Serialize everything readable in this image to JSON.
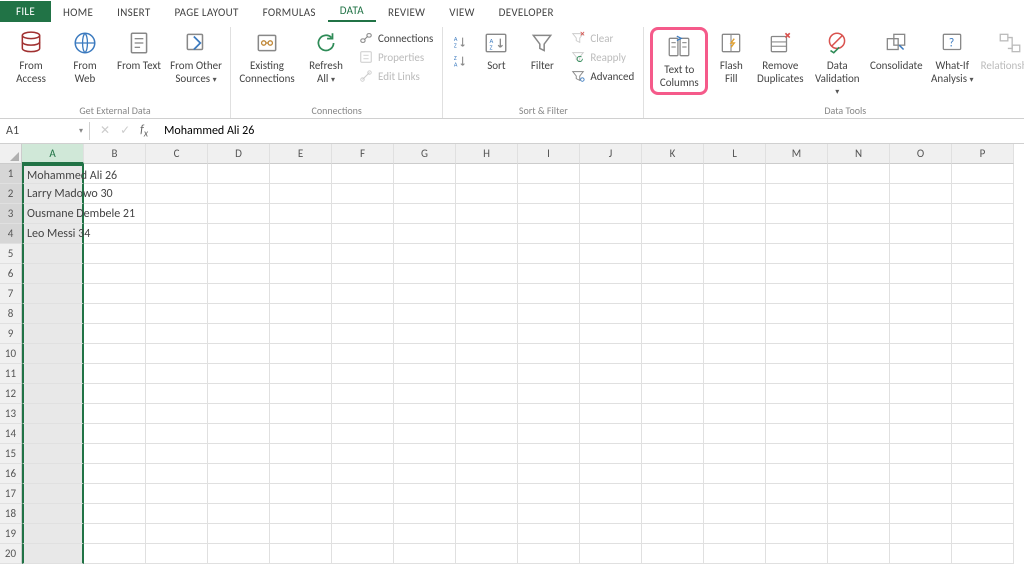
{
  "tabs": {
    "file": "FILE",
    "home": "HOME",
    "insert": "INSERT",
    "page_layout": "PAGE LAYOUT",
    "formulas": "FORMULAS",
    "data": "DATA",
    "review": "REVIEW",
    "view": "VIEW",
    "developer": "DEVELOPER"
  },
  "ribbon": {
    "get_external": {
      "label": "Get External Data",
      "from_access": "From Access",
      "from_web": "From Web",
      "from_text": "From Text",
      "from_other": "From Other Sources"
    },
    "connections": {
      "label": "Connections",
      "existing": "Existing Connections",
      "refresh": "Refresh All",
      "conn": "Connections",
      "props": "Properties",
      "edit": "Edit Links"
    },
    "sort_filter": {
      "label": "Sort & Filter",
      "sort": "Sort",
      "filter": "Filter",
      "clear": "Clear",
      "reapply": "Reapply",
      "advanced": "Advanced"
    },
    "data_tools": {
      "label": "Data Tools",
      "text_columns": "Text to Columns",
      "flash_fill": "Flash Fill",
      "remove_dup": "Remove Duplicates",
      "validation": "Data Validation",
      "consolidate": "Consolidate",
      "whatif": "What-If Analysis",
      "relationships": "Relationships"
    }
  },
  "formula_bar": {
    "name": "A1",
    "value": "Mohammed Ali 26"
  },
  "columns": [
    "A",
    "B",
    "C",
    "D",
    "E",
    "F",
    "G",
    "H",
    "I",
    "J",
    "K",
    "L",
    "M",
    "N",
    "O",
    "P"
  ],
  "selected_column": "A",
  "selected_rows": [
    1,
    2,
    3,
    4
  ],
  "rows": 20,
  "cells": {
    "A1": "Mohammed Ali 26",
    "A2": "Larry Madowo 30",
    "A3": "Ousmane Dembele 21",
    "A4": "Leo Messi 34"
  }
}
